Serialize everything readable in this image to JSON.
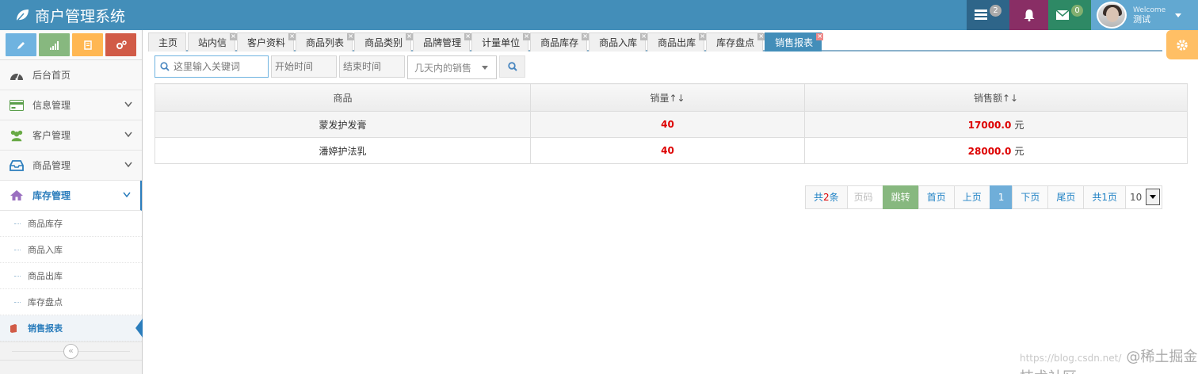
{
  "navbar": {
    "brand": "商户管理系统",
    "tasks_badge": "2",
    "messages_badge": "0",
    "welcome": "Welcome",
    "username": "测试",
    "colors": {
      "bar": "#438eb9",
      "tasks": "#2e6589",
      "notifications": "#892e65",
      "messages": "#2e8965",
      "user": "#62a8d1"
    }
  },
  "shortcuts": [
    {
      "icon": "pencil-icon",
      "color": "#6fb3e0"
    },
    {
      "icon": "signal-icon",
      "color": "#87b87f"
    },
    {
      "icon": "book-icon",
      "color": "#ffb752"
    },
    {
      "icon": "cogs-icon",
      "color": "#d15b47"
    }
  ],
  "sidebar": {
    "items": [
      {
        "label": "后台首页",
        "icon": "dashboard-icon"
      },
      {
        "label": "信息管理",
        "icon": "credit-card-icon"
      },
      {
        "label": "客户管理",
        "icon": "group-icon"
      },
      {
        "label": "商品管理",
        "icon": "inbox-icon"
      },
      {
        "label": "库存管理",
        "icon": "home-icon"
      }
    ],
    "submenu": [
      {
        "label": "商品库存"
      },
      {
        "label": "商品入库"
      },
      {
        "label": "商品出库"
      },
      {
        "label": "库存盘点"
      },
      {
        "label": "销售报表"
      }
    ],
    "collapse_icon": "«"
  },
  "tabs": [
    {
      "label": "主页"
    },
    {
      "label": "站内信"
    },
    {
      "label": "客户资料"
    },
    {
      "label": "商品列表"
    },
    {
      "label": "商品类别"
    },
    {
      "label": "品牌管理"
    },
    {
      "label": "计量单位"
    },
    {
      "label": "商品库存"
    },
    {
      "label": "商品入库"
    },
    {
      "label": "商品出库"
    },
    {
      "label": "库存盘点"
    },
    {
      "label": "销售报表"
    }
  ],
  "search": {
    "keyword_placeholder": "这里输入关键词",
    "start_placeholder": "开始时间",
    "end_placeholder": "结束时间",
    "days_select": "几天内的销售"
  },
  "table": {
    "headers": [
      "商品",
      "销量↑↓",
      "销售额↑↓"
    ],
    "rows": [
      {
        "product": "蒙发护发膏",
        "quantity": "40",
        "amount": "17000.0",
        "unit": "元"
      },
      {
        "product": "潘婷护法乳",
        "quantity": "40",
        "amount": "28000.0",
        "unit": "元"
      }
    ]
  },
  "pager": {
    "total_prefix": "共",
    "total_count": "2",
    "total_suffix": "条",
    "page_input_placeholder": "页码",
    "jump": "跳转",
    "first": "首页",
    "prev": "上页",
    "current": "1",
    "next": "下页",
    "last": "尾页",
    "total_pages": "共1页",
    "page_size": "10"
  },
  "watermark": {
    "url": "https://blog.csdn.net/",
    "text": "@稀土掘金技术社区"
  }
}
